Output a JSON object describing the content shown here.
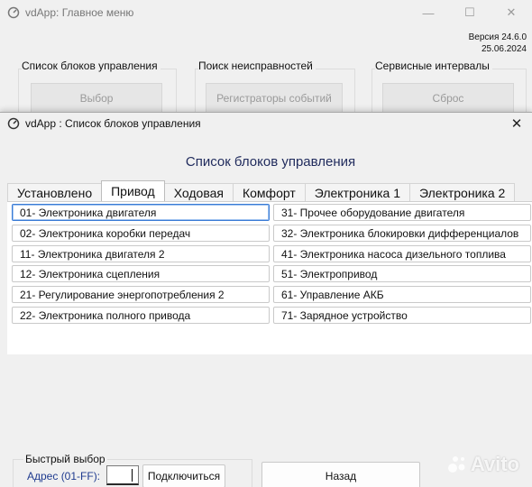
{
  "main_window": {
    "title": "vdApp:  Главное меню",
    "version_line1": "Версия 24.6.0",
    "version_line2": "25.06.2024",
    "groups": [
      {
        "title": "Список блоков управления",
        "button": "Выбор"
      },
      {
        "title": "Поиск неисправностей",
        "button": "Регистраторы событий"
      },
      {
        "title": "Сервисные интервалы",
        "button": "Сброс"
      }
    ],
    "controls": {
      "minimize": "—",
      "maximize": "☐",
      "close": "✕"
    }
  },
  "dialog": {
    "title": "vdApp :  Список блоков управления",
    "close": "✕",
    "heading": "Список блоков управления",
    "tabs": [
      {
        "label": "Установлено",
        "active": false
      },
      {
        "label": "Привод",
        "active": true
      },
      {
        "label": "Ходовая",
        "active": false
      },
      {
        "label": "Комфорт",
        "active": false
      },
      {
        "label": "Электроника 1",
        "active": false
      },
      {
        "label": "Электроника 2",
        "active": false
      }
    ],
    "units_left": [
      "01- Электроника двигателя",
      "02- Электроника коробки передач",
      "11- Электроника двигателя 2",
      "12- Электроника сцепления",
      "21- Регулирование энергопотребления 2",
      "22- Электроника полного привода"
    ],
    "units_right": [
      "31- Прочее оборудование двигателя",
      "32- Электроника блокировки дифференциалов",
      "41- Электроника насоса дизельного топлива",
      "51- Электропривод",
      "61- Управление АКБ",
      "71- Зарядное устройство"
    ],
    "quick_select": {
      "title": "Быстрый выбор",
      "address_label": "Адрес (01-FF):",
      "address_value": "",
      "connect_button": "Подключиться"
    },
    "back_button": "Назад"
  },
  "watermark": {
    "text": "Avito"
  }
}
